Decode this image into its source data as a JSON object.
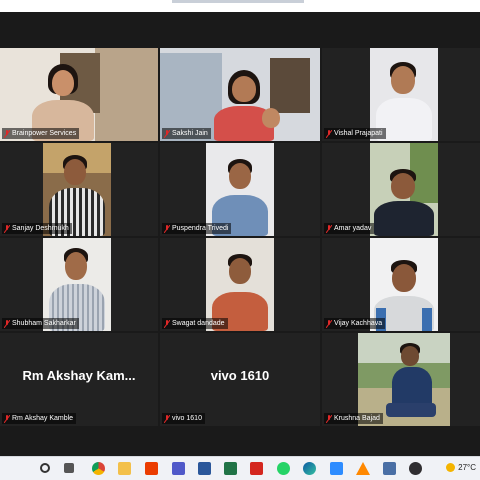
{
  "meeting": {
    "participants": [
      {
        "name": "Brainpower Services",
        "muted": true,
        "active_speaker": true,
        "video": true
      },
      {
        "name": "Sakshi Jain",
        "muted": true,
        "video": true
      },
      {
        "name": "Vishal Prajapati",
        "muted": true,
        "video": true
      },
      {
        "name": "Sanjay Deshmukh",
        "muted": true,
        "video": true
      },
      {
        "name": "Puspendra Trivedi",
        "muted": true,
        "video": true
      },
      {
        "name": "Amar yadav",
        "muted": true,
        "video": true
      },
      {
        "name": "Shubham Sakharkar",
        "muted": true,
        "video": true
      },
      {
        "name": "Swagat dandade",
        "muted": true,
        "video": true
      },
      {
        "name": "Vijay Kachhava",
        "muted": true,
        "video": true
      },
      {
        "name": "Rm Akshay Kamble",
        "display_name": "Rm Akshay Kam...",
        "muted": true,
        "video": false
      },
      {
        "name": "vivo 1610",
        "display_name": "vivo 1610",
        "muted": true,
        "video": false
      },
      {
        "name": "Krushna Bajad",
        "muted": true,
        "video": true
      }
    ]
  },
  "taskbar": {
    "icons": [
      "search-icon",
      "task-view-icon",
      "chrome-icon",
      "file-explorer-icon",
      "office-icon",
      "teams-icon",
      "word-icon",
      "excel-icon",
      "acrobat-icon",
      "whatsapp-icon",
      "edge-icon",
      "zoom-icon",
      "vlc-icon",
      "calculator-icon",
      "obs-icon"
    ],
    "temperature": "27°C"
  },
  "colors": {
    "active_speaker_border": "#e6d55c",
    "tile_background": "#222222",
    "mic_muted": "#e02828"
  }
}
